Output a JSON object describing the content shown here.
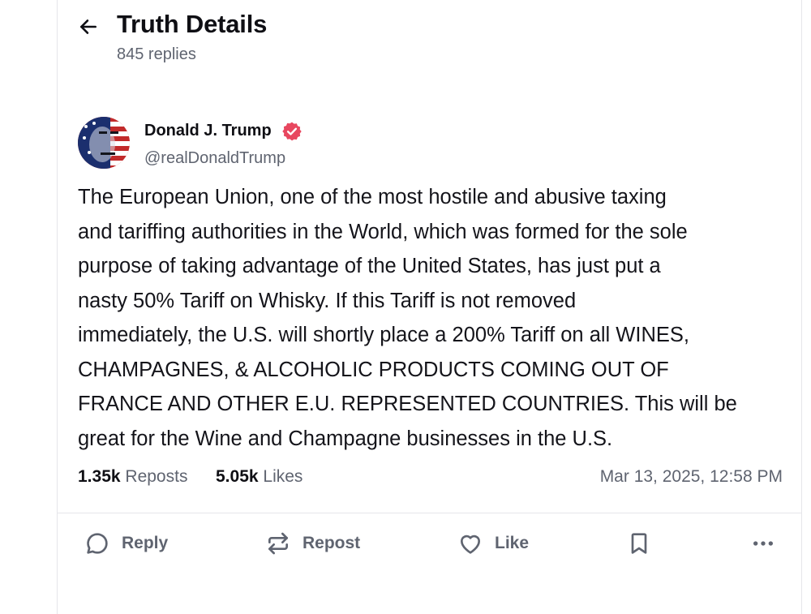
{
  "header": {
    "title": "Truth Details",
    "subtitle": "845 replies"
  },
  "post": {
    "author_name": "Donald J. Trump",
    "author_handle": "@realDonaldTrump",
    "body": "The European Union, one of the most hostile and abusive taxing\nand tariffing authorities in the World, which was formed for the sole\npurpose of taking advantage of the United States, has just put a\nnasty 50% Tariff on Whisky. If this Tariff is not removed\nimmediately, the U.S. will shortly place a 200% Tariff on all WINES,\nCHAMPAGNES, & ALCOHOLIC PRODUCTS COMING OUT OF\nFRANCE AND OTHER E.U. REPRESENTED COUNTRIES. This will be\ngreat for the Wine and Champagne businesses in the U.S.",
    "reposts_count": "1.35k",
    "reposts_label": "Reposts",
    "likes_count": "5.05k",
    "likes_label": "Likes",
    "timestamp": "Mar 13, 2025, 12:58 PM"
  },
  "actions": {
    "reply_label": "Reply",
    "repost_label": "Repost",
    "like_label": "Like"
  },
  "icons": [
    "back-arrow-icon",
    "verified-badge-icon",
    "reply-icon",
    "repost-icon",
    "heart-icon",
    "bookmark-icon",
    "more-icon"
  ],
  "colors": {
    "verified": "#e8475f",
    "muted_text": "#5f6470",
    "text": "#0f0f14",
    "border": "#e6e6ea"
  }
}
